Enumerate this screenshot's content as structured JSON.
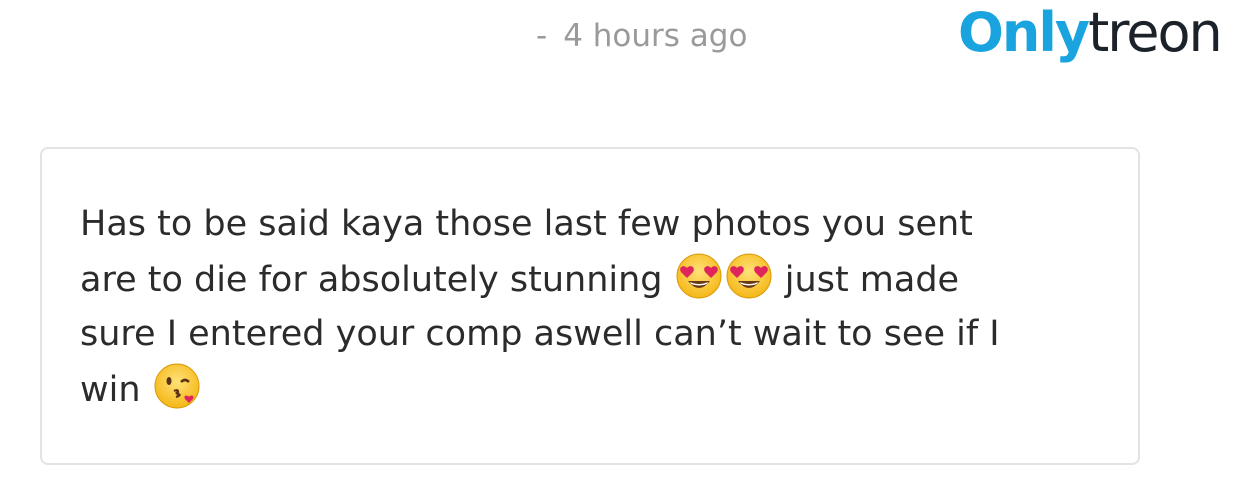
{
  "header": {
    "timestamp_dash": "-",
    "timestamp": "4 hours ago",
    "watermark_part1": "Only",
    "watermark_part2": "treon",
    "watermark_colors": {
      "part1": "#1aa4df",
      "part2": "#1b2229"
    }
  },
  "message": {
    "text_line1": "Has to be said kaya those last few photos you sent",
    "text_line2_start": "are to die for absolutely stunning",
    "emoji_1": "heart-eyes-emoji",
    "emoji_2": "heart-eyes-emoji",
    "text_line2_end": "just made",
    "text_line3": "sure I entered your comp aswell can’t wait to see if I",
    "text_line4": "win",
    "emoji_3": "kiss-wink-emoji"
  }
}
